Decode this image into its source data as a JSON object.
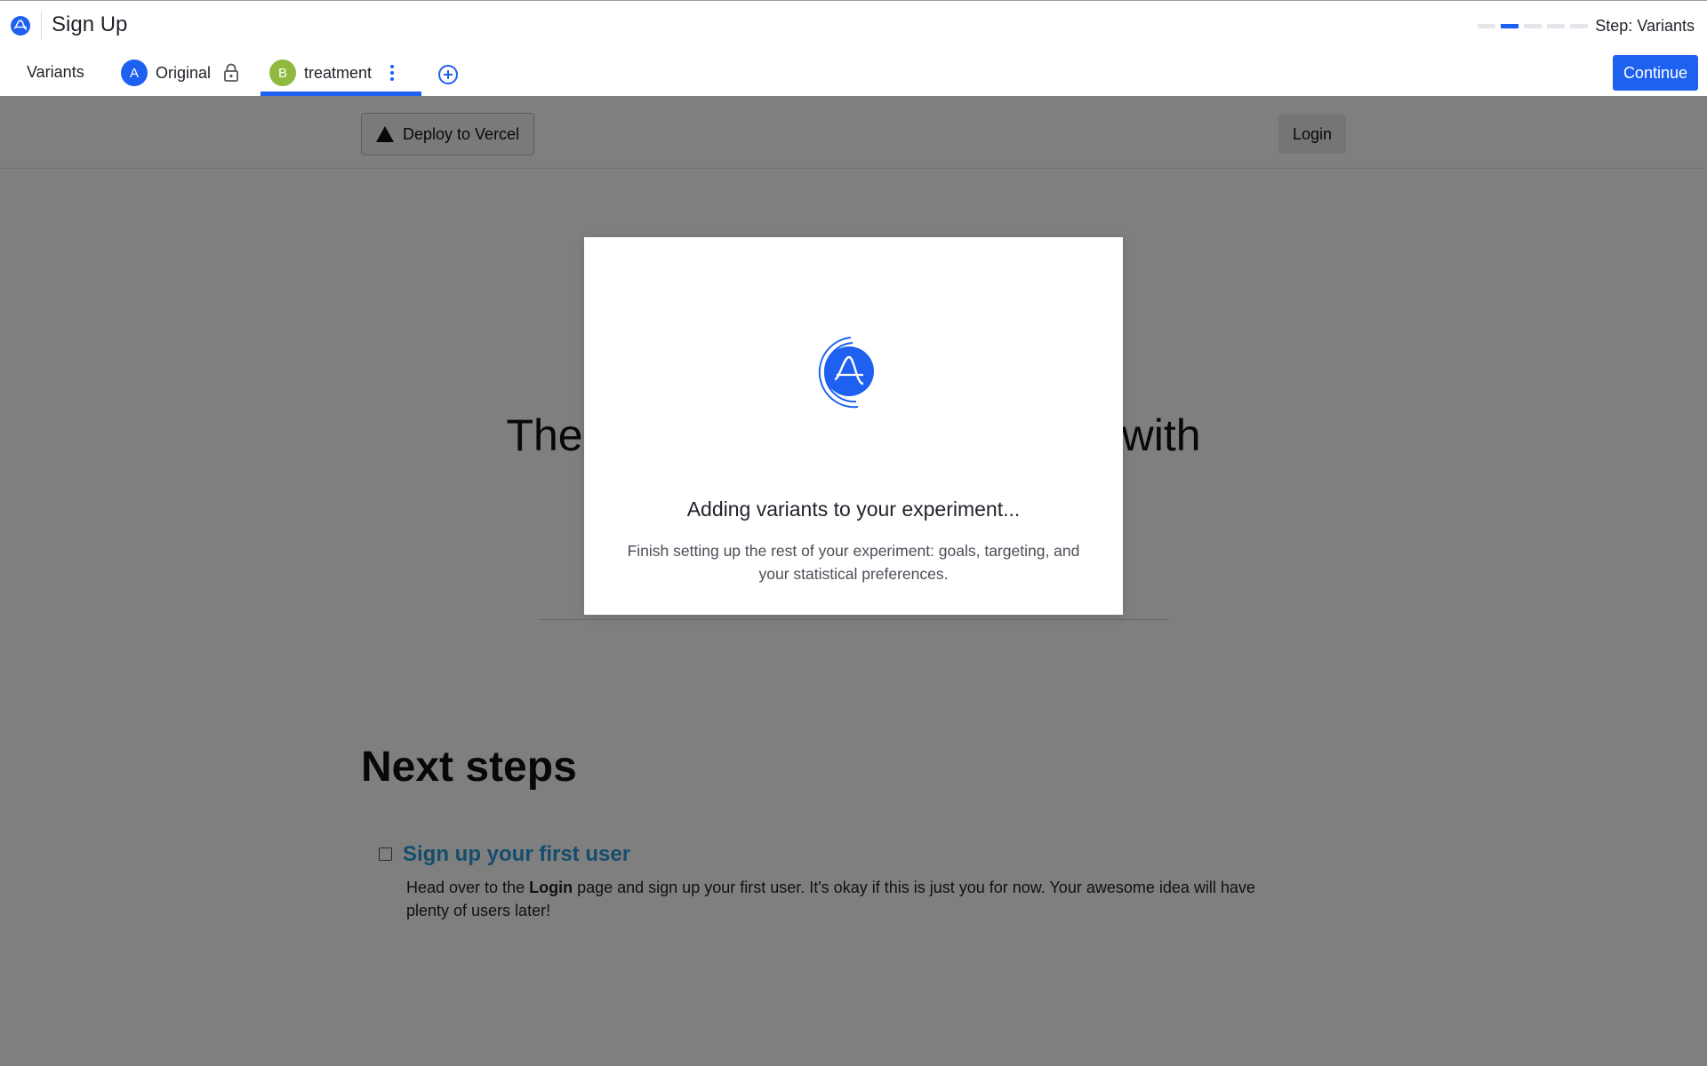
{
  "header": {
    "title": "Sign Up",
    "step_label": "Step: Variants",
    "progress": {
      "total_steps": 5,
      "current_step": 2
    }
  },
  "tabs": {
    "variants_label": "Variants",
    "variants": [
      {
        "letter": "A",
        "name": "Original",
        "locked": true,
        "color": "#1e61f0"
      },
      {
        "letter": "B",
        "name": "treatment",
        "selected": true,
        "color": "#8fba3f"
      }
    ],
    "continue_label": "Continue"
  },
  "preview": {
    "deploy_label": "Deploy to Vercel",
    "login_label": "Login",
    "hero_left": "The",
    "hero_right": "with",
    "next_steps_title": "Next steps",
    "checklist": [
      {
        "title": "Sign up your first user",
        "desc_before": "Head over to the ",
        "desc_bold": "Login",
        "desc_after": " page and sign up your first user. It's okay if this is just you for now. Your awesome idea will have plenty of users later!"
      }
    ]
  },
  "modal": {
    "title": "Adding variants to your experiment...",
    "description": "Finish setting up the rest of your experiment: goals, targeting, and your statistical preferences."
  },
  "colors": {
    "accent": "#1e61f0",
    "variant_b": "#8fba3f",
    "link": "#2a9ad8"
  }
}
